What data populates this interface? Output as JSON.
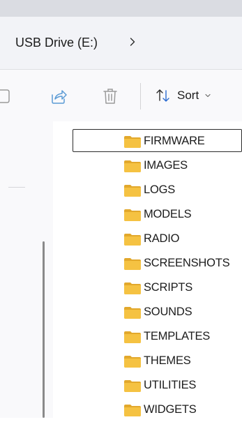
{
  "address_bar": {
    "breadcrumb": "USB Drive (E:)",
    "chevron_icon": "chevron-right-icon"
  },
  "toolbar": {
    "icons": [
      "rename-icon",
      "share-icon",
      "delete-icon"
    ],
    "sort_label": "Sort",
    "sort_icon": "sort-arrows-icon",
    "sort_caret_icon": "chevron-down-icon"
  },
  "files": [
    {
      "name": "FIRMWARE",
      "icon": "folder-icon"
    },
    {
      "name": "IMAGES",
      "icon": "folder-icon"
    },
    {
      "name": "LOGS",
      "icon": "folder-icon"
    },
    {
      "name": "MODELS",
      "icon": "folder-icon"
    },
    {
      "name": "RADIO",
      "icon": "folder-icon"
    },
    {
      "name": "SCREENSHOTS",
      "icon": "folder-icon"
    },
    {
      "name": "SCRIPTS",
      "icon": "folder-icon"
    },
    {
      "name": "SOUNDS",
      "icon": "folder-icon"
    },
    {
      "name": "TEMPLATES",
      "icon": "folder-icon"
    },
    {
      "name": "THEMES",
      "icon": "folder-icon"
    },
    {
      "name": "UTILITIES",
      "icon": "folder-icon"
    },
    {
      "name": "WIDGETS",
      "icon": "folder-icon"
    }
  ],
  "selected_file": "FIRMWARE",
  "colors": {
    "folder_body": "#f5c242",
    "folder_tab": "#e2a82c",
    "share_icon": "#5b9bd5",
    "icon_gray": "#9a9a9a"
  }
}
